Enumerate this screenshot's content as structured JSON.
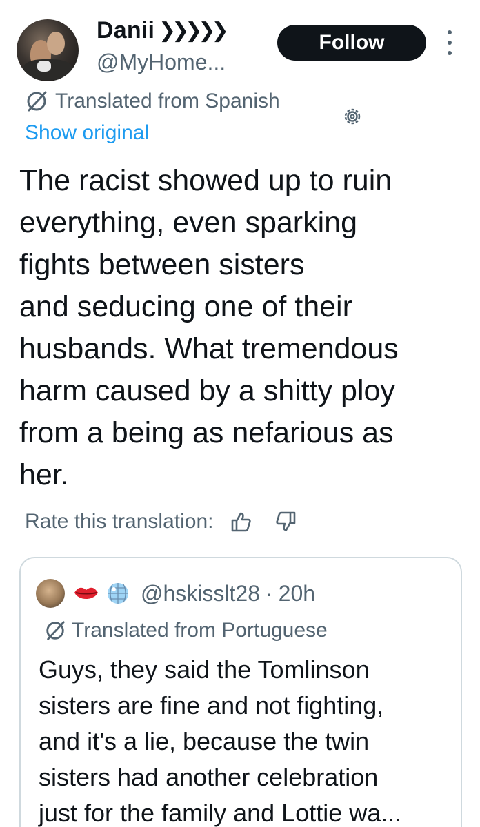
{
  "author": {
    "display_name": "Danii",
    "name_suffix": "❯❯❯❯❯",
    "handle": "@MyHome..."
  },
  "follow_label": "Follow",
  "translation": {
    "label": "Translated from Spanish",
    "show_original": "Show original"
  },
  "tweet_text": "The racist showed up to ruin\neverything, even sparking\nfights between sisters\nand seducing one of their\nhusbands. What tremendous\nharm caused by a shitty ploy\nfrom a being as nefarious as\nher.",
  "rate_label": "Rate this translation:",
  "quote": {
    "handle": "@hskisslt28",
    "separator": "·",
    "time": "20h",
    "translation_label": "Translated from Portuguese",
    "text": "Guys, they said the Tomlinson\nsisters are fine and not fighting,\nand it's a lie, because the twin\nsisters had another celebration\njust for the family and Lottie wa..."
  },
  "colors": {
    "text_primary": "#0f1419",
    "text_secondary": "#536471",
    "link": "#1d9bf0",
    "border": "#cfd9de"
  },
  "icons": [
    "avatar",
    "more-icon",
    "translate-icon",
    "gear-icon",
    "thumbs-up-icon",
    "thumbs-down-icon",
    "lips-icon",
    "disco-ball-icon"
  ]
}
